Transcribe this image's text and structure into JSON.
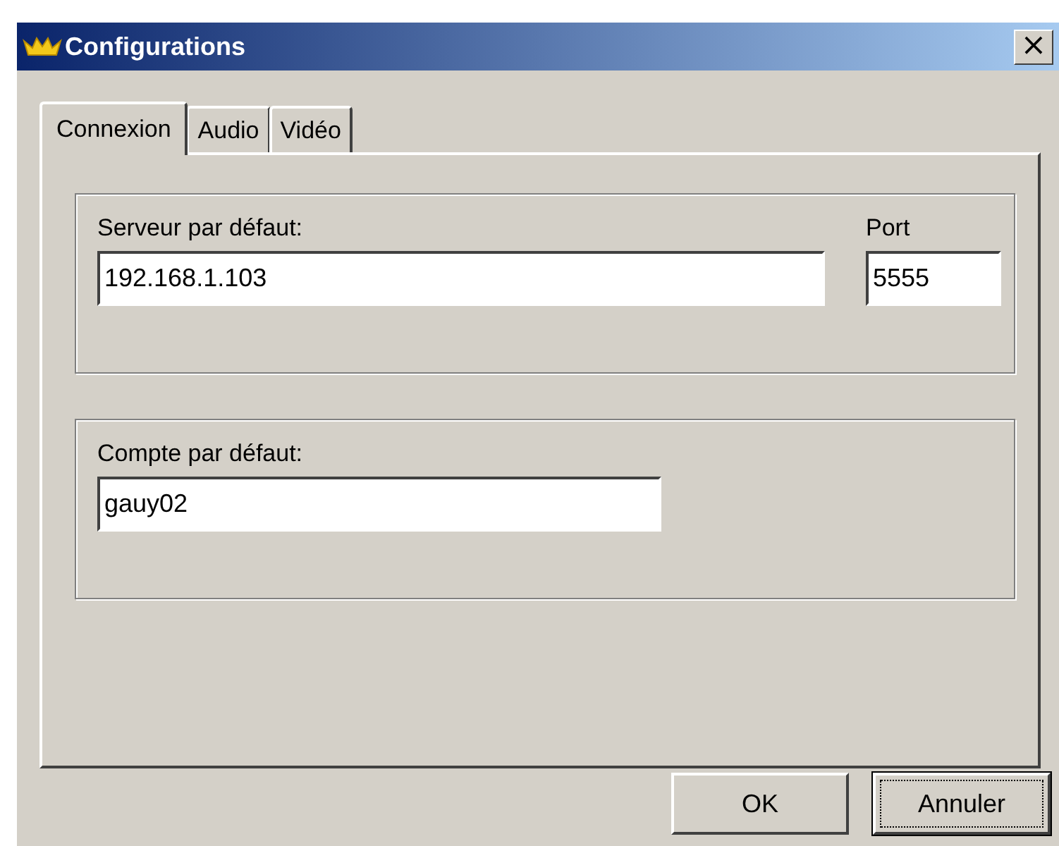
{
  "window": {
    "title": "Configurations",
    "close": "×"
  },
  "tabs": [
    {
      "label": "Connexion",
      "selected": true
    },
    {
      "label": "Audio",
      "selected": false
    },
    {
      "label": "Vidéo",
      "selected": false
    }
  ],
  "groups": [
    {
      "fields": [
        {
          "label": "Serveur par défaut:",
          "value": "192.168.1.103"
        },
        {
          "label": "Port",
          "value": "5555"
        }
      ]
    },
    {
      "fields": [
        {
          "label": "Compte par défaut:",
          "value": "gauy02"
        }
      ]
    }
  ],
  "buttons": [
    {
      "label": "OK",
      "focused": false
    },
    {
      "label": "Annuler",
      "focused": true
    }
  ]
}
